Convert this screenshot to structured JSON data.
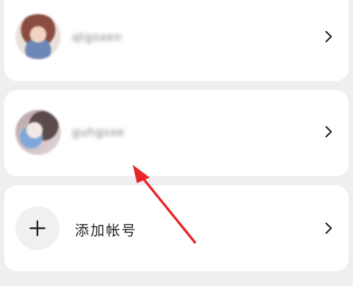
{
  "accounts": [
    {
      "name": "qtgsxen",
      "avatar_icon": "avatar-icon"
    },
    {
      "name": "guhgsxe",
      "avatar_icon": "avatar-icon"
    }
  ],
  "add_account": {
    "label": "添加帐号",
    "icon": "plus-icon"
  },
  "chevron_icon": "chevron-right-icon",
  "annotation": {
    "icon": "red-arrow-icon",
    "color": "#e8252b"
  },
  "colors": {
    "background": "#efeff1",
    "card": "#ffffff",
    "text": "#222222"
  }
}
